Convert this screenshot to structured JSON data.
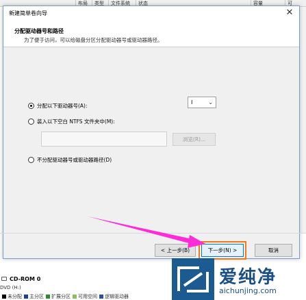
{
  "background": {
    "columns": [
      "布局",
      "类型",
      "文件系统",
      "状态",
      "容量",
      "可"
    ],
    "left_fragments": [
      "\u0000"
    ]
  },
  "dialog": {
    "title": "新建简单卷向导",
    "close_label": "✕",
    "page_title": "分配驱动器号和路径",
    "page_subtitle": "为了便于访问，可以给磁盘分区分配驱动器号或驱动器路径。",
    "options": {
      "assign_letter": "分配以下驱动器号(A):",
      "mount_folder": "装入以下空白 NTFS 文件夹中(M):",
      "no_assign": "不分配驱动器号或驱动器路径(D)"
    },
    "drive_letter": "I",
    "browse_label": "浏览(R)...",
    "back_label": "< 上一步(B)",
    "next_label": "下一步(N) >",
    "cancel_label": "取消"
  },
  "disk": {
    "name": "CD-ROM 0",
    "sub": "DVD (H:)",
    "legend": [
      {
        "label": "未分配",
        "color": "#000000"
      },
      {
        "label": "主分区",
        "color": "#1e3c9a"
      },
      {
        "label": "扩展分区",
        "color": "#2e8b2e"
      },
      {
        "label": "可用空间",
        "color": "#88c060"
      },
      {
        "label": "逻辑驱动器",
        "color": "#2a4fb0"
      }
    ]
  },
  "watermark": {
    "text": "爱纯净",
    "url": "aichunjing.com"
  },
  "colors": {
    "highlight": "#f07a1a",
    "arrow": "#ff2bd8",
    "brand": "#1c5b92"
  }
}
